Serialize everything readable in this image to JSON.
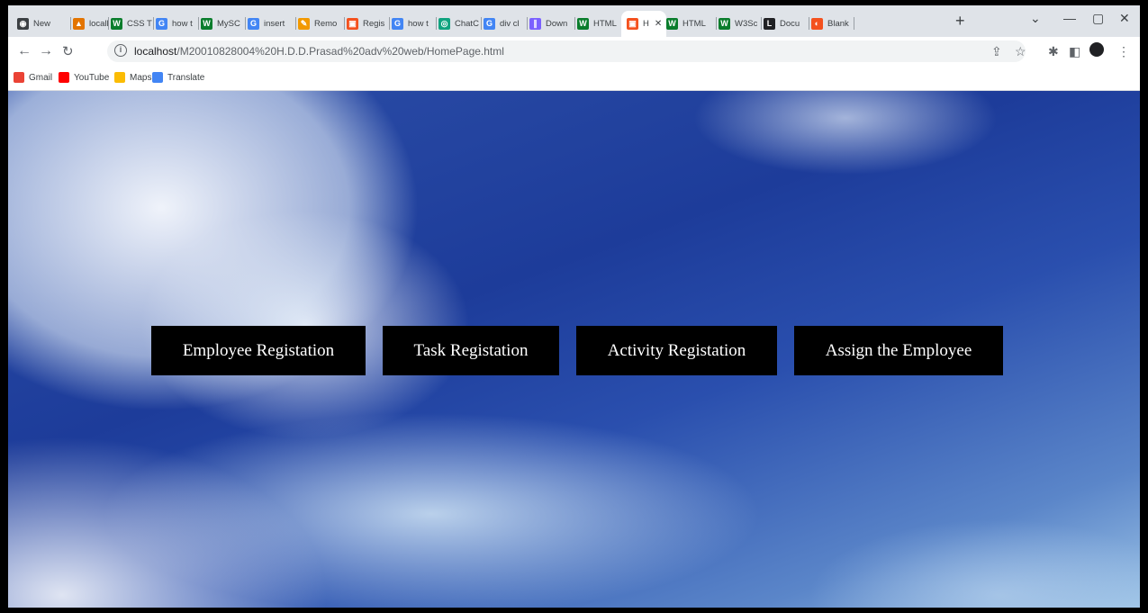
{
  "browser": {
    "tabs": [
      {
        "label": "New",
        "color": "#3c4043",
        "glyph": "◉"
      },
      {
        "label": "localh",
        "color": "#e37400",
        "glyph": "▲"
      },
      {
        "label": "CSS T",
        "color": "#0a7d2c",
        "glyph": "W"
      },
      {
        "label": "how t",
        "color": "#4285f4",
        "glyph": "G"
      },
      {
        "label": "MySC",
        "color": "#0a7d2c",
        "glyph": "W"
      },
      {
        "label": "insert",
        "color": "#4285f4",
        "glyph": "G"
      },
      {
        "label": "Remo",
        "color": "#f29900",
        "glyph": "✎"
      },
      {
        "label": "Regis",
        "color": "#f4511e",
        "glyph": "▣"
      },
      {
        "label": "how t",
        "color": "#4285f4",
        "glyph": "G"
      },
      {
        "label": "ChatC",
        "color": "#10a37f",
        "glyph": "◎"
      },
      {
        "label": "div cl",
        "color": "#4285f4",
        "glyph": "G"
      },
      {
        "label": "Down",
        "color": "#7b61ff",
        "glyph": "∥"
      },
      {
        "label": "HTML",
        "color": "#0a7d2c",
        "glyph": "W"
      },
      {
        "label": "H",
        "color": "#f4511e",
        "glyph": "▣"
      },
      {
        "label": "HTML",
        "color": "#0a7d2c",
        "glyph": "W"
      },
      {
        "label": "W3Sc",
        "color": "#0a7d2c",
        "glyph": "W"
      },
      {
        "label": "Docu",
        "color": "#202124",
        "glyph": "L"
      },
      {
        "label": "Blank",
        "color": "#f4511e",
        "glyph": "◐"
      }
    ],
    "url_host": "localhost",
    "url_path": "/M20010828004%20H.D.D.Prasad%20adv%20web/HomePage.html",
    "bookmarks": [
      {
        "label": "Gmail",
        "color": "#ea4335"
      },
      {
        "label": "YouTube",
        "color": "#ff0000"
      },
      {
        "label": "Maps",
        "color": "#fbbc04"
      },
      {
        "label": "Translate",
        "color": "#4285f4"
      }
    ]
  },
  "page": {
    "buttons": [
      {
        "label": "Employee Registation"
      },
      {
        "label": "Task Registation"
      },
      {
        "label": "Activity Registation"
      },
      {
        "label": "Assign the Employee"
      }
    ]
  }
}
